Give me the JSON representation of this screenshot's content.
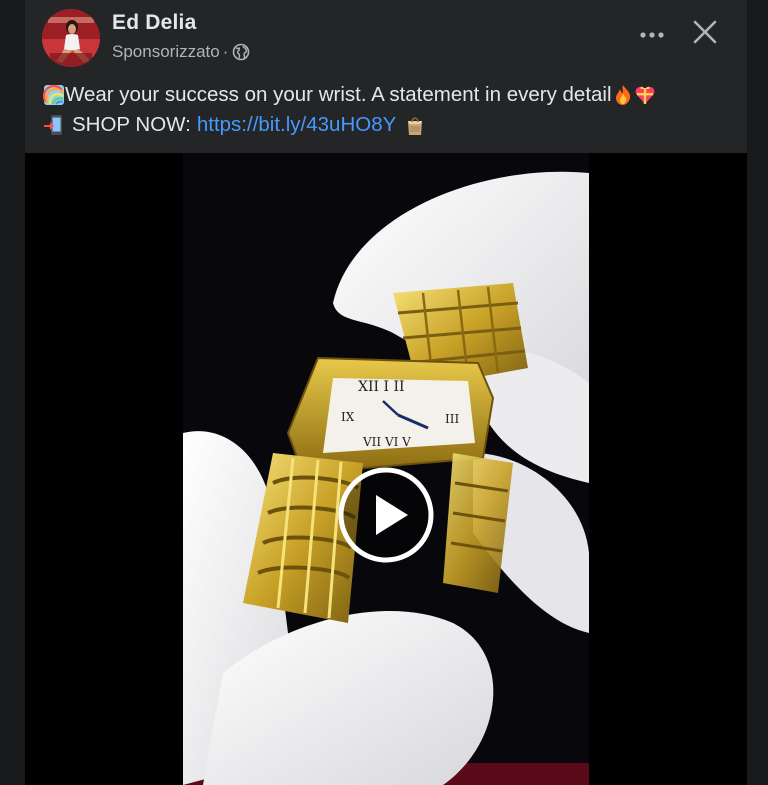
{
  "post": {
    "author_name": "Ed Delia",
    "sponsored_label": "Sponsorizzato",
    "separator": "·",
    "audience_icon": "globe-icon",
    "more_icon": "more-options-icon",
    "close_icon": "close-icon",
    "caption_line1_text": "Wear your success on your wrist. A statement in every detail",
    "caption_line1_emojis": [
      "rainbow-icon",
      "fire-icon",
      "gift-heart-icon"
    ],
    "caption_line2_prefix": "SHOP NOW: ",
    "caption_link": "https://bit.ly/43uHO8Y",
    "caption_line2_emojis": [
      "phone-arrow-icon",
      "shopping-bag-icon"
    ]
  },
  "media": {
    "type": "video",
    "play_icon": "play-icon"
  },
  "colors": {
    "background": "#18191a",
    "card": "#242526",
    "text_primary": "#e4e6eb",
    "text_secondary": "#b0b3b8",
    "link": "#4599ff"
  }
}
